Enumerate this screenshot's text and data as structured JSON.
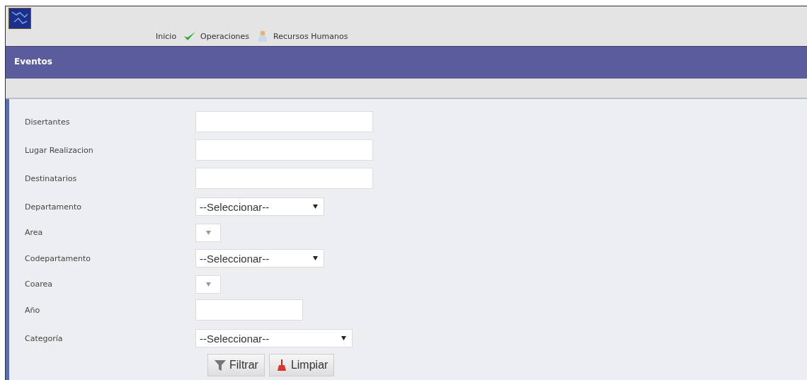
{
  "nav": {
    "items": [
      {
        "label": "Inicio"
      },
      {
        "label": "Operaciones"
      },
      {
        "label": "Recursos Humanos"
      }
    ]
  },
  "header": {
    "title": "Eventos"
  },
  "form": {
    "fields": [
      {
        "label": "Disertantes",
        "kind": "text"
      },
      {
        "label": "Lugar Realizacion",
        "kind": "text"
      },
      {
        "label": "Destinatarios",
        "kind": "text"
      },
      {
        "label": "Departamento",
        "kind": "select",
        "value": "--Seleccionar--"
      },
      {
        "label": "Area",
        "kind": "empty-select"
      },
      {
        "label": "Codepartamento",
        "kind": "select",
        "value": "--Seleccionar--"
      },
      {
        "label": "Coarea",
        "kind": "empty-select"
      },
      {
        "label": "Año",
        "kind": "short-text"
      },
      {
        "label": "Categoría",
        "kind": "wide-select",
        "value": "--Seleccionar--"
      }
    ],
    "buttons": [
      {
        "label": "Filtrar"
      },
      {
        "label": "Limpiar"
      }
    ]
  }
}
